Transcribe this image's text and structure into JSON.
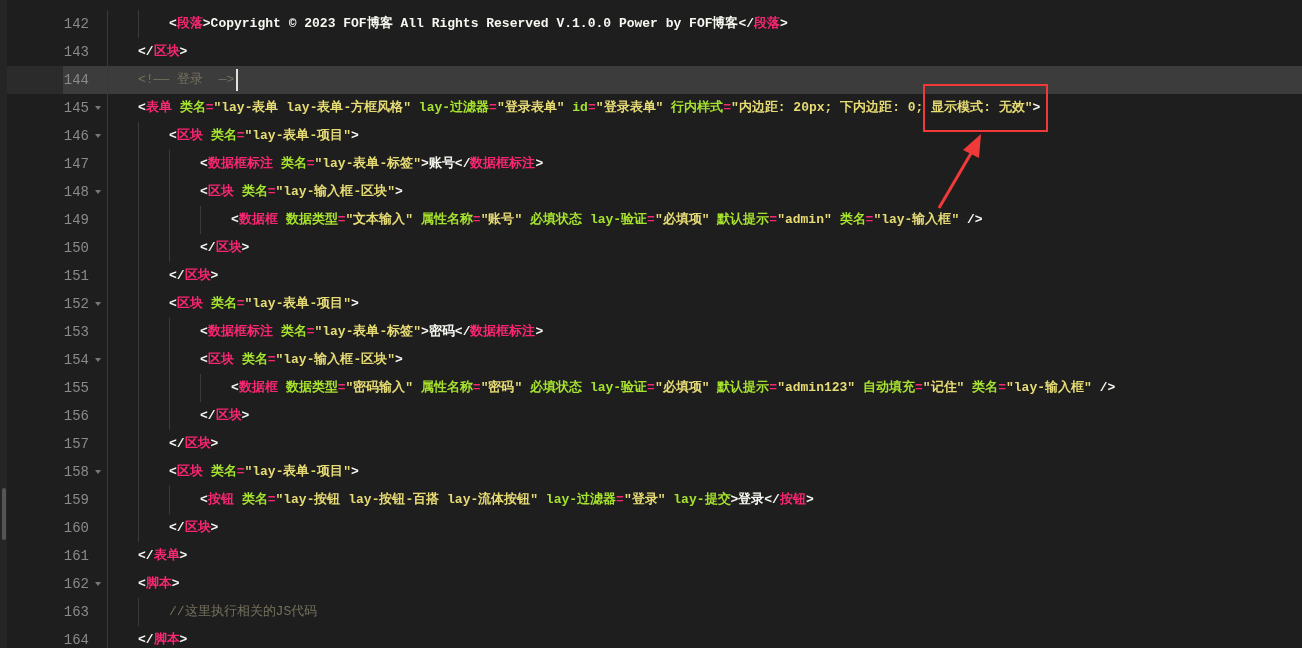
{
  "editor": {
    "lines": [
      {
        "children": [
          {
            "number": "142",
            "foldable": false,
            "current": false,
            "tokens": [
              {
                "kind": "punct",
                "text": "<"
              },
              {
                "kind": "tag",
                "text": "段落"
              },
              {
                "kind": "text",
                "text": ">Copyright © 2023 FOF博客 All Rights Reserved V.1.0.0 Power by FOF博客</"
              },
              {
                "kind": "tag",
                "text": "段落"
              },
              {
                "kind": "punct",
                "text": ">"
              }
            ]
          }
        ]
      },
      {
        "number": "143",
        "foldable": false,
        "current": false,
        "tokens": [
          {
            "kind": "punct",
            "text": "</"
          },
          {
            "kind": "tag",
            "text": "区块"
          },
          {
            "kind": "punct",
            "text": ">"
          }
        ]
      },
      {
        "number": "144",
        "foldable": false,
        "current": true,
        "tokens": [
          {
            "kind": "comment",
            "text": "<!—— 登录  —>"
          }
        ]
      },
      {
        "number": "145",
        "foldable": true,
        "current": false,
        "tokens": [
          {
            "kind": "punct",
            "text": "<"
          },
          {
            "kind": "tag",
            "text": "表单"
          },
          {
            "kind": "attr",
            "text": " 类名"
          },
          {
            "kind": "eq",
            "text": "="
          },
          {
            "kind": "string",
            "text": "\"lay-表单 lay-表单-方框风格\""
          },
          {
            "kind": "attr",
            "text": " lay-过滤器"
          },
          {
            "kind": "eq",
            "text": "="
          },
          {
            "kind": "string",
            "text": "\"登录表单\""
          },
          {
            "kind": "attr",
            "text": " id"
          },
          {
            "kind": "eq",
            "text": "="
          },
          {
            "kind": "string",
            "text": "\"登录表单\""
          },
          {
            "kind": "attr",
            "text": " 行内样式"
          },
          {
            "kind": "eq",
            "text": "="
          },
          {
            "kind": "string",
            "text": "\"内边距: 20px; 下内边距: 0; "
          },
          {
            "kind": "string",
            "text": "显示模式: 无效\"",
            "boxed": true
          },
          {
            "kind": "punct",
            "text": ">",
            "boxed": true
          }
        ],
        "children": [
          {
            "number": "146",
            "foldable": true,
            "current": false,
            "tokens": [
              {
                "kind": "punct",
                "text": "<"
              },
              {
                "kind": "tag",
                "text": "区块"
              },
              {
                "kind": "attr",
                "text": " 类名"
              },
              {
                "kind": "eq",
                "text": "="
              },
              {
                "kind": "string",
                "text": "\"lay-表单-项目\""
              },
              {
                "kind": "punct",
                "text": ">"
              }
            ],
            "children": [
              {
                "number": "147",
                "foldable": false,
                "current": false,
                "tokens": [
                  {
                    "kind": "punct",
                    "text": "<"
                  },
                  {
                    "kind": "tag",
                    "text": "数据框标注"
                  },
                  {
                    "kind": "attr",
                    "text": " 类名"
                  },
                  {
                    "kind": "eq",
                    "text": "="
                  },
                  {
                    "kind": "string",
                    "text": "\"lay-表单-标签\""
                  },
                  {
                    "kind": "text",
                    "text": ">账号</"
                  },
                  {
                    "kind": "tag",
                    "text": "数据框标注"
                  },
                  {
                    "kind": "punct",
                    "text": ">"
                  }
                ]
              },
              {
                "number": "148",
                "foldable": true,
                "current": false,
                "tokens": [
                  {
                    "kind": "punct",
                    "text": "<"
                  },
                  {
                    "kind": "tag",
                    "text": "区块"
                  },
                  {
                    "kind": "attr",
                    "text": " 类名"
                  },
                  {
                    "kind": "eq",
                    "text": "="
                  },
                  {
                    "kind": "string",
                    "text": "\"lay-输入框-区块\""
                  },
                  {
                    "kind": "punct",
                    "text": ">"
                  }
                ],
                "children": [
                  {
                    "number": "149",
                    "foldable": false,
                    "current": false,
                    "tokens": [
                      {
                        "kind": "punct",
                        "text": "<"
                      },
                      {
                        "kind": "tag",
                        "text": "数据框"
                      },
                      {
                        "kind": "attr",
                        "text": " 数据类型"
                      },
                      {
                        "kind": "eq",
                        "text": "="
                      },
                      {
                        "kind": "string",
                        "text": "\"文本输入\""
                      },
                      {
                        "kind": "attr",
                        "text": " 属性名称"
                      },
                      {
                        "kind": "eq",
                        "text": "="
                      },
                      {
                        "kind": "string",
                        "text": "\"账号\""
                      },
                      {
                        "kind": "attr",
                        "text": " 必填状态 lay-验证"
                      },
                      {
                        "kind": "eq",
                        "text": "="
                      },
                      {
                        "kind": "string",
                        "text": "\"必填项\""
                      },
                      {
                        "kind": "attr",
                        "text": " 默认提示"
                      },
                      {
                        "kind": "eq",
                        "text": "="
                      },
                      {
                        "kind": "string",
                        "text": "\"admin\""
                      },
                      {
                        "kind": "attr",
                        "text": " 类名"
                      },
                      {
                        "kind": "eq",
                        "text": "="
                      },
                      {
                        "kind": "string",
                        "text": "\"lay-输入框\""
                      },
                      {
                        "kind": "punct",
                        "text": " />"
                      }
                    ]
                  }
                ]
              },
              {
                "number": "150",
                "foldable": false,
                "current": false,
                "tokens": [
                  {
                    "kind": "punct",
                    "text": "</"
                  },
                  {
                    "kind": "tag",
                    "text": "区块"
                  },
                  {
                    "kind": "punct",
                    "text": ">"
                  }
                ]
              }
            ]
          },
          {
            "number": "151",
            "foldable": false,
            "current": false,
            "tokens": [
              {
                "kind": "punct",
                "text": "</"
              },
              {
                "kind": "tag",
                "text": "区块"
              },
              {
                "kind": "punct",
                "text": ">"
              }
            ]
          },
          {
            "number": "152",
            "foldable": true,
            "current": false,
            "tokens": [
              {
                "kind": "punct",
                "text": "<"
              },
              {
                "kind": "tag",
                "text": "区块"
              },
              {
                "kind": "attr",
                "text": " 类名"
              },
              {
                "kind": "eq",
                "text": "="
              },
              {
                "kind": "string",
                "text": "\"lay-表单-项目\""
              },
              {
                "kind": "punct",
                "text": ">"
              }
            ],
            "children": [
              {
                "number": "153",
                "foldable": false,
                "current": false,
                "tokens": [
                  {
                    "kind": "punct",
                    "text": "<"
                  },
                  {
                    "kind": "tag",
                    "text": "数据框标注"
                  },
                  {
                    "kind": "attr",
                    "text": " 类名"
                  },
                  {
                    "kind": "eq",
                    "text": "="
                  },
                  {
                    "kind": "string",
                    "text": "\"lay-表单-标签\""
                  },
                  {
                    "kind": "text",
                    "text": ">密码</"
                  },
                  {
                    "kind": "tag",
                    "text": "数据框标注"
                  },
                  {
                    "kind": "punct",
                    "text": ">"
                  }
                ]
              },
              {
                "number": "154",
                "foldable": true,
                "current": false,
                "tokens": [
                  {
                    "kind": "punct",
                    "text": "<"
                  },
                  {
                    "kind": "tag",
                    "text": "区块"
                  },
                  {
                    "kind": "attr",
                    "text": " 类名"
                  },
                  {
                    "kind": "eq",
                    "text": "="
                  },
                  {
                    "kind": "string",
                    "text": "\"lay-输入框-区块\""
                  },
                  {
                    "kind": "punct",
                    "text": ">"
                  }
                ],
                "children": [
                  {
                    "number": "155",
                    "foldable": false,
                    "current": false,
                    "tokens": [
                      {
                        "kind": "punct",
                        "text": "<"
                      },
                      {
                        "kind": "tag",
                        "text": "数据框"
                      },
                      {
                        "kind": "attr",
                        "text": " 数据类型"
                      },
                      {
                        "kind": "eq",
                        "text": "="
                      },
                      {
                        "kind": "string",
                        "text": "\"密码输入\""
                      },
                      {
                        "kind": "attr",
                        "text": " 属性名称"
                      },
                      {
                        "kind": "eq",
                        "text": "="
                      },
                      {
                        "kind": "string",
                        "text": "\"密码\""
                      },
                      {
                        "kind": "attr",
                        "text": " 必填状态 lay-验证"
                      },
                      {
                        "kind": "eq",
                        "text": "="
                      },
                      {
                        "kind": "string",
                        "text": "\"必填项\""
                      },
                      {
                        "kind": "attr",
                        "text": " 默认提示"
                      },
                      {
                        "kind": "eq",
                        "text": "="
                      },
                      {
                        "kind": "string",
                        "text": "\"admin123\""
                      },
                      {
                        "kind": "attr",
                        "text": " 自动填充"
                      },
                      {
                        "kind": "eq",
                        "text": "="
                      },
                      {
                        "kind": "string",
                        "text": "\"记住\""
                      },
                      {
                        "kind": "attr",
                        "text": " 类名"
                      },
                      {
                        "kind": "eq",
                        "text": "="
                      },
                      {
                        "kind": "string",
                        "text": "\"lay-输入框\""
                      },
                      {
                        "kind": "punct",
                        "text": " />"
                      }
                    ]
                  }
                ]
              },
              {
                "number": "156",
                "foldable": false,
                "current": false,
                "tokens": [
                  {
                    "kind": "punct",
                    "text": "</"
                  },
                  {
                    "kind": "tag",
                    "text": "区块"
                  },
                  {
                    "kind": "punct",
                    "text": ">"
                  }
                ]
              }
            ]
          },
          {
            "number": "157",
            "foldable": false,
            "current": false,
            "tokens": [
              {
                "kind": "punct",
                "text": "</"
              },
              {
                "kind": "tag",
                "text": "区块"
              },
              {
                "kind": "punct",
                "text": ">"
              }
            ]
          },
          {
            "number": "158",
            "foldable": true,
            "current": false,
            "tokens": [
              {
                "kind": "punct",
                "text": "<"
              },
              {
                "kind": "tag",
                "text": "区块"
              },
              {
                "kind": "attr",
                "text": " 类名"
              },
              {
                "kind": "eq",
                "text": "="
              },
              {
                "kind": "string",
                "text": "\"lay-表单-项目\""
              },
              {
                "kind": "punct",
                "text": ">"
              }
            ],
            "children": [
              {
                "number": "159",
                "foldable": false,
                "current": false,
                "tokens": [
                  {
                    "kind": "punct",
                    "text": "<"
                  },
                  {
                    "kind": "tag",
                    "text": "按钮"
                  },
                  {
                    "kind": "attr",
                    "text": " 类名"
                  },
                  {
                    "kind": "eq",
                    "text": "="
                  },
                  {
                    "kind": "string",
                    "text": "\"lay-按钮 lay-按钮-百搭 lay-流体按钮\""
                  },
                  {
                    "kind": "attr",
                    "text": " lay-过滤器"
                  },
                  {
                    "kind": "eq",
                    "text": "="
                  },
                  {
                    "kind": "string",
                    "text": "\"登录\""
                  },
                  {
                    "kind": "attr",
                    "text": " lay-提交"
                  },
                  {
                    "kind": "text",
                    "text": ">登录</"
                  },
                  {
                    "kind": "tag",
                    "text": "按钮"
                  },
                  {
                    "kind": "punct",
                    "text": ">"
                  }
                ]
              }
            ]
          },
          {
            "number": "160",
            "foldable": false,
            "current": false,
            "tokens": [
              {
                "kind": "punct",
                "text": "</"
              },
              {
                "kind": "tag",
                "text": "区块"
              },
              {
                "kind": "punct",
                "text": ">"
              }
            ]
          }
        ]
      },
      {
        "number": "161",
        "foldable": false,
        "current": false,
        "tokens": [
          {
            "kind": "punct",
            "text": "</"
          },
          {
            "kind": "tag",
            "text": "表单"
          },
          {
            "kind": "punct",
            "text": ">"
          }
        ]
      },
      {
        "number": "162",
        "foldable": true,
        "current": false,
        "tokens": [
          {
            "kind": "punct",
            "text": "<"
          },
          {
            "kind": "tag",
            "text": "脚本"
          },
          {
            "kind": "punct",
            "text": ">"
          }
        ],
        "children": [
          {
            "number": "163",
            "foldable": false,
            "current": false,
            "tokens": [
              {
                "kind": "comment",
                "text": "//这里执行相关的JS代码"
              }
            ]
          }
        ]
      },
      {
        "number": "164",
        "foldable": false,
        "current": false,
        "tokens": [
          {
            "kind": "punct",
            "text": "</"
          },
          {
            "kind": "tag",
            "text": "脚本"
          },
          {
            "kind": "punct",
            "text": ">"
          }
        ]
      }
    ]
  }
}
